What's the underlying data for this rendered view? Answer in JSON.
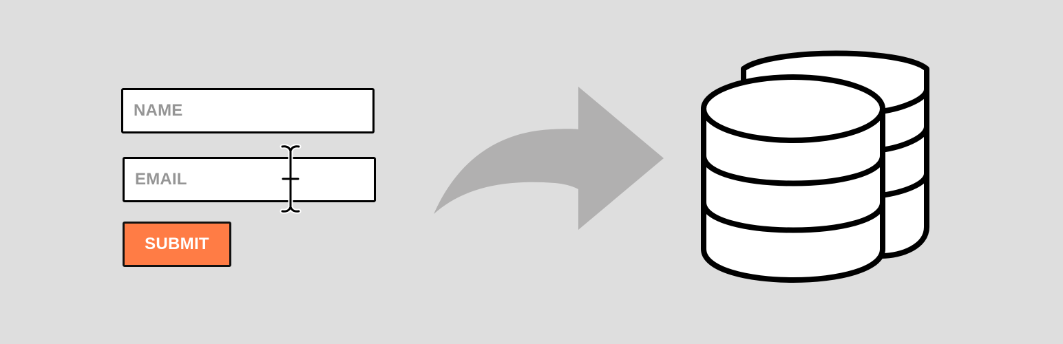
{
  "form": {
    "name_placeholder": "NAME",
    "email_placeholder": "EMAIL",
    "submit_label": "SUBMIT"
  },
  "icons": {
    "cursor": "text-cursor-icon",
    "arrow": "curved-arrow-right-icon",
    "database": "database-icon"
  },
  "colors": {
    "background": "#dedede",
    "submit_button": "#ff7c45",
    "placeholder_text": "#959595",
    "arrow": "#b1b0b0"
  }
}
